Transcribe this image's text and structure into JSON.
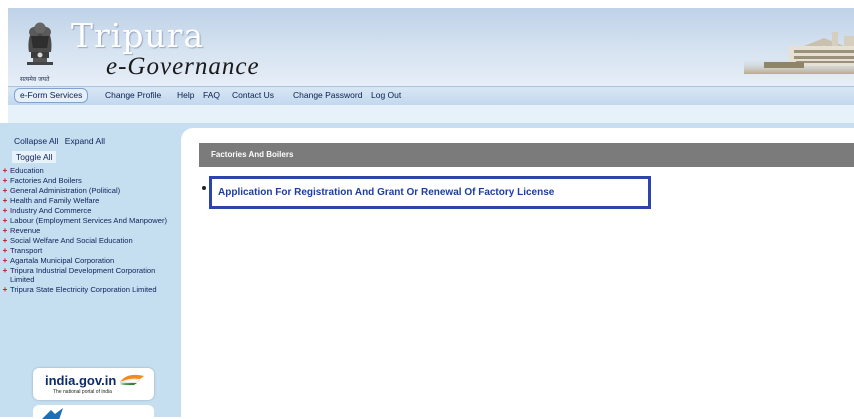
{
  "header": {
    "title": "Tripura",
    "subtitle": "e-Governance",
    "emblem_caption": "सत्यमेव जयते"
  },
  "nav": {
    "items": [
      {
        "label": "e-Form Services",
        "active": true
      },
      {
        "label": "Change Profile"
      },
      {
        "label": "Help"
      },
      {
        "label": "FAQ"
      },
      {
        "label": "Contact Us"
      },
      {
        "label": "Change Password"
      },
      {
        "label": "Log Out"
      }
    ]
  },
  "sidebar": {
    "collapse_all": "Collapse All",
    "expand_all": "Expand All",
    "toggle_all": "Toggle All",
    "tree": [
      "Education",
      "Factories And Boilers",
      "General Administration (Political)",
      "Health and Family Welfare",
      "Industry And Commerce",
      "Labour (Employment Services And Manpower)",
      "Revenue",
      "Social Welfare And Social Education",
      "Transport",
      "Agartala Municipal Corporation",
      "Tripura Industrial Development Corporation Limited",
      "Tripura State Electricity Corporation Limited"
    ],
    "india_logo": {
      "title": "india.gov.in",
      "subtitle": "The national portal of india"
    }
  },
  "main": {
    "section_title": "Factories And Boilers",
    "link": "Application For Registration And Grant Or Renewal Of Factory License"
  },
  "colors": {
    "header_bg": "#c9dbee",
    "sidebar_bg": "#c5def0",
    "section_header_bg": "#7b7b7b",
    "link_color": "#1b3ea0",
    "highlight_border": "#2b45a8",
    "tree_plus": "#c01818"
  }
}
